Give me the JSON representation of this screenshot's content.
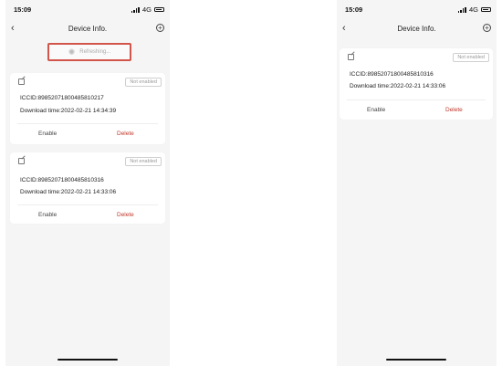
{
  "left_phone": {
    "status": {
      "time": "15:09",
      "network": "4G"
    },
    "nav": {
      "title": "Device Info.",
      "back_icon": "chevron-left-icon",
      "add_icon": "plus-circle-icon"
    },
    "refresh": {
      "text": "Refreshing...",
      "border_color": "#d1554a"
    },
    "cards": [
      {
        "badge": "Not enabled",
        "iccid": "ICCID:89852071800485810217",
        "download": "Download time:2022-02-21 14:34:39",
        "enable_label": "Enable",
        "delete_label": "Delete"
      },
      {
        "badge": "Not enabled",
        "iccid": "ICCID:89852071800485810316",
        "download": "Download time:2022-02-21 14:33:06",
        "enable_label": "Enable",
        "delete_label": "Delete"
      }
    ]
  },
  "right_phone": {
    "status": {
      "time": "15:09",
      "network": "4G"
    },
    "nav": {
      "title": "Device Info.",
      "back_icon": "chevron-left-icon",
      "add_icon": "plus-circle-icon"
    },
    "cards": [
      {
        "badge": "Not enabled",
        "iccid": "ICCID:89852071800485810316",
        "download": "Download time:2022-02-21 14:33:06",
        "enable_label": "Enable",
        "delete_label": "Delete"
      }
    ]
  },
  "colors": {
    "delete": "#c0392b",
    "highlight": "#d1554a",
    "background": "#f5f5f5"
  }
}
